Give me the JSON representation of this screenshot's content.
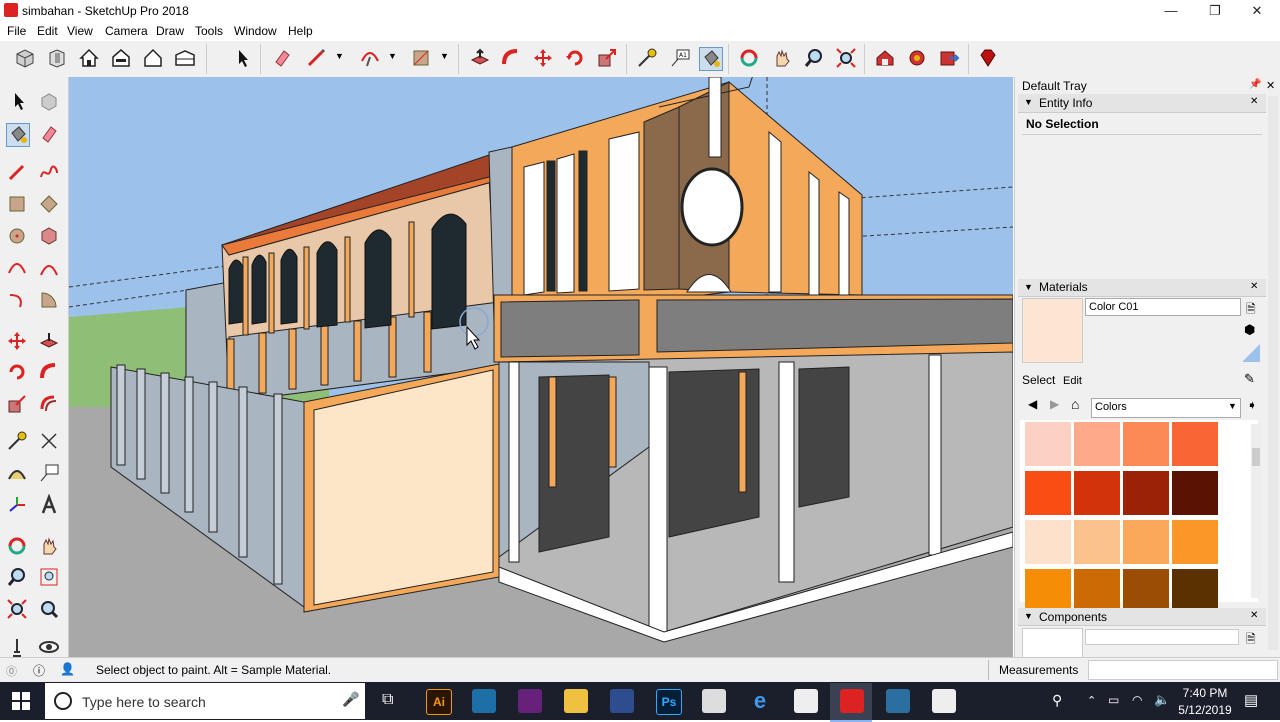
{
  "window": {
    "title": "simbahan - SketchUp Pro 2018",
    "minimize": "—",
    "maximize": "❐",
    "close": "✕"
  },
  "menu": [
    "File",
    "Edit",
    "View",
    "Camera",
    "Draw",
    "Tools",
    "Window",
    "Help"
  ],
  "tray": {
    "title": "Default Tray",
    "entity_info": {
      "title": "Entity Info",
      "selection": "No Selection"
    },
    "materials": {
      "title": "Materials",
      "material_name": "Color C01",
      "preview_color": "#fde5d3",
      "tabs": [
        "Select",
        "Edit"
      ],
      "library": "Colors",
      "swatches": [
        "#fdd0c4",
        "#fda98a",
        "#fb8a57",
        "#f96633",
        "#fa4d14",
        "#d3330b",
        "#9b2207",
        "#5a1303",
        "#fde1ca",
        "#fcc28e",
        "#fba85a",
        "#f99729",
        "#f68d06",
        "#cc6a03",
        "#9a4d03",
        "#5c3102"
      ]
    },
    "components": {
      "title": "Components"
    }
  },
  "status": {
    "message": "Select object to paint. Alt = Sample Material.",
    "measurements_label": "Measurements",
    "measurements_value": ""
  },
  "taskbar": {
    "search_placeholder": "Type here to search",
    "time": "7:40 PM",
    "date": "5/12/2019"
  },
  "colors": {
    "sky": "#9cc2ec",
    "ground": "#a8a8a8",
    "grass": "#8fbf76",
    "accent_orange": "#f4a85a",
    "wall_beige": "#f0d2b0",
    "taskbar": "#1a1f2b"
  }
}
